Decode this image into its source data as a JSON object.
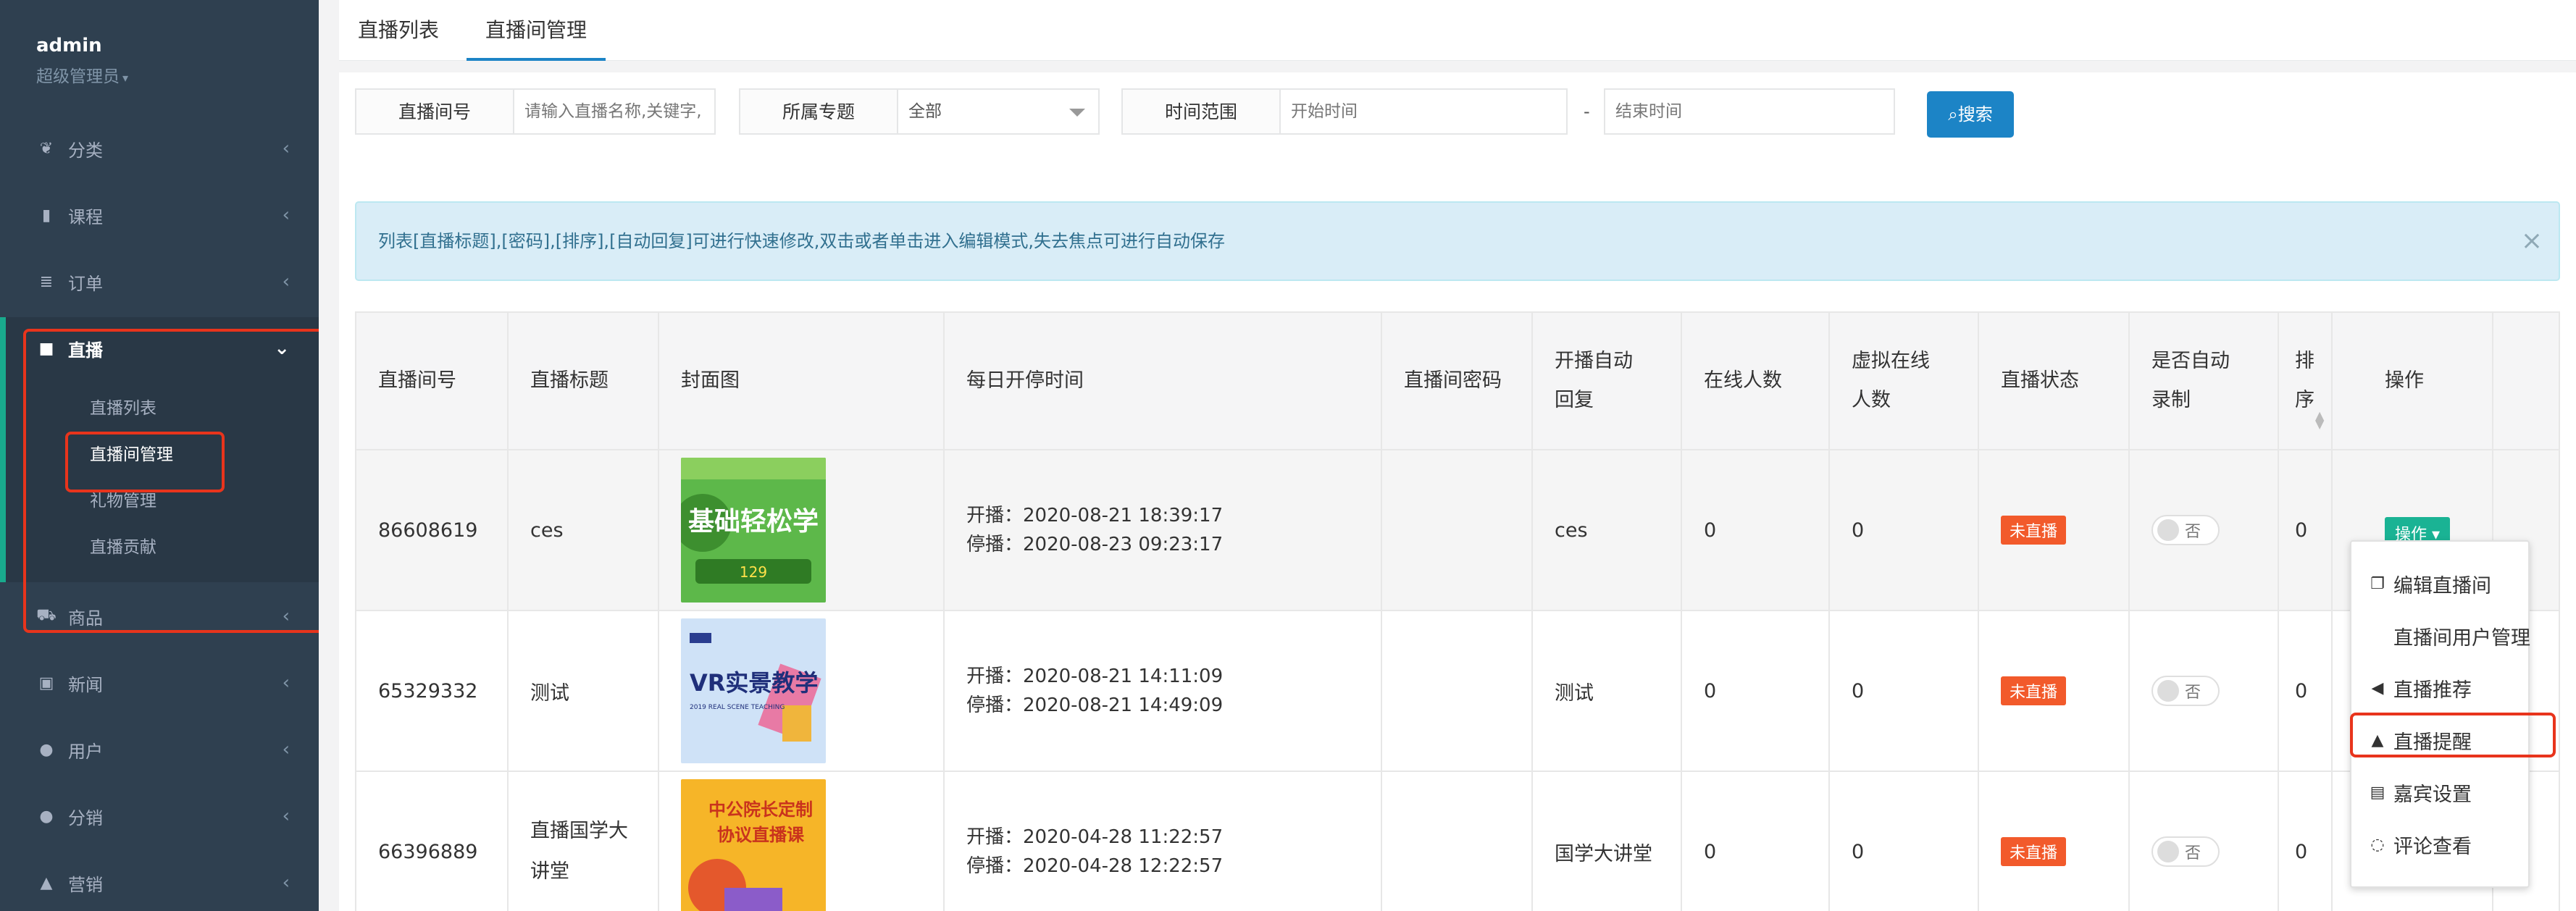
{
  "user": {
    "name": "admin",
    "role": "超级管理员"
  },
  "sidebar": {
    "items": [
      {
        "label": "分类"
      },
      {
        "label": "课程"
      },
      {
        "label": "订单"
      },
      {
        "label": "直播"
      },
      {
        "label": "商品"
      },
      {
        "label": "新闻"
      },
      {
        "label": "用户"
      },
      {
        "label": "分销"
      },
      {
        "label": "营销"
      }
    ],
    "live_sub": [
      "直播列表",
      "直播间管理",
      "礼物管理",
      "直播贡献"
    ]
  },
  "tabs": [
    "直播列表",
    "直播间管理"
  ],
  "filters": {
    "room_no_label": "直播间号",
    "room_no_placeholder": "请输入直播名称,关键字,",
    "topic_label": "所属专题",
    "topic_value": "全部",
    "time_label": "时间范围",
    "start_placeholder": "开始时间",
    "dash": "-",
    "end_placeholder": "结束时间",
    "search_label": "搜索"
  },
  "alert": {
    "text": "列表[直播标题],[密码],[排序],[自动回复]可进行快速修改,双击或者单击进入编辑模式,失去焦点可进行自动保存",
    "close": "×"
  },
  "table": {
    "headers": [
      "直播间号",
      "直播标题",
      "封面图",
      "每日开停时间",
      "直播间密码",
      "开播自动回复",
      "在线人数",
      "虚拟在线人数",
      "直播状态",
      "是否自动录制",
      "排序",
      "操作"
    ],
    "rows": [
      {
        "room_no": "86608619",
        "title": "ces",
        "start": "开播：2020-08-21 18:39:17",
        "stop": "停播：2020-08-23 09:23:17",
        "password": "",
        "auto_reply": "ces",
        "online": "0",
        "virtual_online": "0",
        "status": "未直播",
        "record": "否",
        "sort": "0",
        "ops": "操作"
      },
      {
        "room_no": "65329332",
        "title": "测试",
        "start": "开播：2020-08-21 14:11:09",
        "stop": "停播：2020-08-21 14:49:09",
        "password": "",
        "auto_reply": "测试",
        "online": "0",
        "virtual_online": "0",
        "status": "未直播",
        "record": "否",
        "sort": "0",
        "ops": ""
      },
      {
        "room_no": "66396889",
        "title": "直播国学大讲堂",
        "start": "开播：2020-04-28 11:22:57",
        "stop": "停播：2020-04-28 12:22:57",
        "password": "",
        "auto_reply": "国学大讲堂",
        "online": "0",
        "virtual_online": "0",
        "status": "未直播",
        "record": "否",
        "sort": "0",
        "ops": ""
      }
    ],
    "covers": [
      {
        "line1": "基础轻松学",
        "line2": "129"
      },
      {
        "line1": "VR实景教学",
        "line2": "2019 REAL SCENE TEACHING"
      },
      {
        "line1": "中公院长定制",
        "line2": "协议直播课"
      }
    ]
  },
  "dropdown": [
    "编辑直播间",
    "直播间用户管理",
    "直播推荐",
    "直播提醒",
    "嘉宾设置",
    "评论查看"
  ],
  "colors": {
    "sidebar": "#2f4050",
    "primary": "#1c84c6",
    "success": "#1ab394",
    "danger": "#f25a2b",
    "highlight": "#e8341c"
  }
}
